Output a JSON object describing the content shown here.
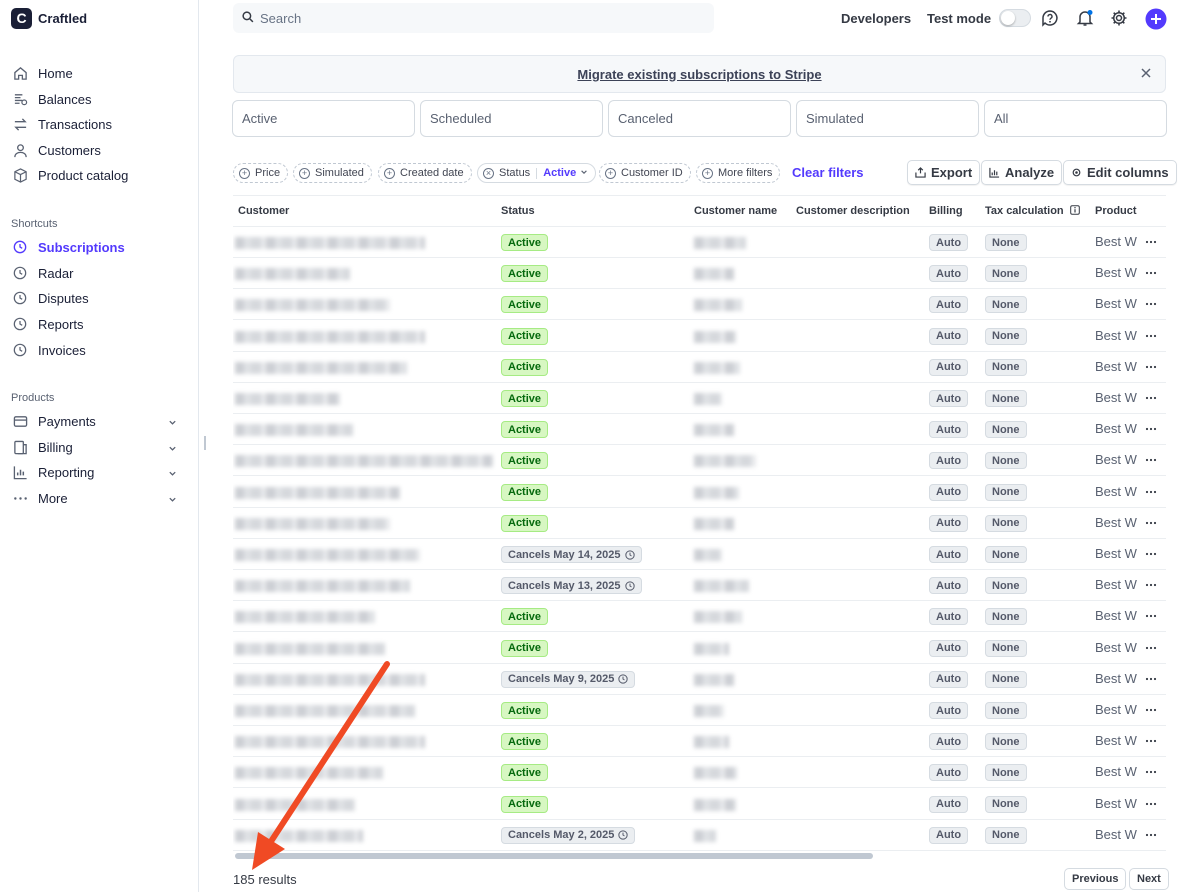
{
  "app": {
    "name": "Craftled",
    "logo_letter": "C"
  },
  "sidebar": {
    "items": [
      {
        "label": "Home",
        "icon": "home-icon"
      },
      {
        "label": "Balances",
        "icon": "balances-icon"
      },
      {
        "label": "Transactions",
        "icon": "transactions-icon"
      },
      {
        "label": "Customers",
        "icon": "customers-icon"
      },
      {
        "label": "Product catalog",
        "icon": "product-catalog-icon"
      }
    ],
    "shortcuts_label": "Shortcuts",
    "shortcuts": [
      {
        "label": "Subscriptions",
        "active": true
      },
      {
        "label": "Radar"
      },
      {
        "label": "Disputes"
      },
      {
        "label": "Reports"
      },
      {
        "label": "Invoices"
      }
    ],
    "products_label": "Products",
    "products": [
      {
        "label": "Payments",
        "icon": "payments-icon"
      },
      {
        "label": "Billing",
        "icon": "billing-icon"
      },
      {
        "label": "Reporting",
        "icon": "reporting-icon"
      },
      {
        "label": "More",
        "icon": "more-icon"
      }
    ]
  },
  "topbar": {
    "search_placeholder": "Search",
    "developers": "Developers",
    "test_mode": "Test mode"
  },
  "banner": {
    "text": "Migrate existing subscriptions to Stripe"
  },
  "status_tabs": [
    "Active",
    "Scheduled",
    "Canceled",
    "Simulated",
    "All"
  ],
  "filters": {
    "price": "Price",
    "simulated": "Simulated",
    "created_date": "Created date",
    "status": "Status",
    "status_value": "Active",
    "customer_id": "Customer ID",
    "more_filters": "More filters",
    "clear": "Clear filters"
  },
  "actions": {
    "export": "Export",
    "analyze": "Analyze",
    "edit_columns": "Edit columns"
  },
  "table": {
    "columns": [
      "Customer",
      "Status",
      "Customer name",
      "Customer description",
      "Billing",
      "Tax calculation",
      "Product"
    ],
    "billing_value": "Auto",
    "tax_value": "None",
    "product_value": "Best W",
    "rows": [
      {
        "status": "Active",
        "type": "active"
      },
      {
        "status": "Active",
        "type": "active"
      },
      {
        "status": "Active",
        "type": "active"
      },
      {
        "status": "Active",
        "type": "active"
      },
      {
        "status": "Active",
        "type": "active"
      },
      {
        "status": "Active",
        "type": "active"
      },
      {
        "status": "Active",
        "type": "active"
      },
      {
        "status": "Active",
        "type": "active"
      },
      {
        "status": "Active",
        "type": "active"
      },
      {
        "status": "Active",
        "type": "active"
      },
      {
        "status": "Cancels May 14, 2025",
        "type": "cancel"
      },
      {
        "status": "Cancels May 13, 2025",
        "type": "cancel"
      },
      {
        "status": "Active",
        "type": "active"
      },
      {
        "status": "Active",
        "type": "active"
      },
      {
        "status": "Cancels May 9, 2025",
        "type": "cancel"
      },
      {
        "status": "Active",
        "type": "active"
      },
      {
        "status": "Active",
        "type": "active"
      },
      {
        "status": "Active",
        "type": "active"
      },
      {
        "status": "Active",
        "type": "active"
      },
      {
        "status": "Cancels May 2, 2025",
        "type": "cancel"
      }
    ]
  },
  "footer": {
    "count": "185",
    "results_label": "results",
    "previous": "Previous",
    "next": "Next"
  },
  "colors": {
    "accent": "#533afd",
    "annotation_arrow": "#f04a24"
  }
}
